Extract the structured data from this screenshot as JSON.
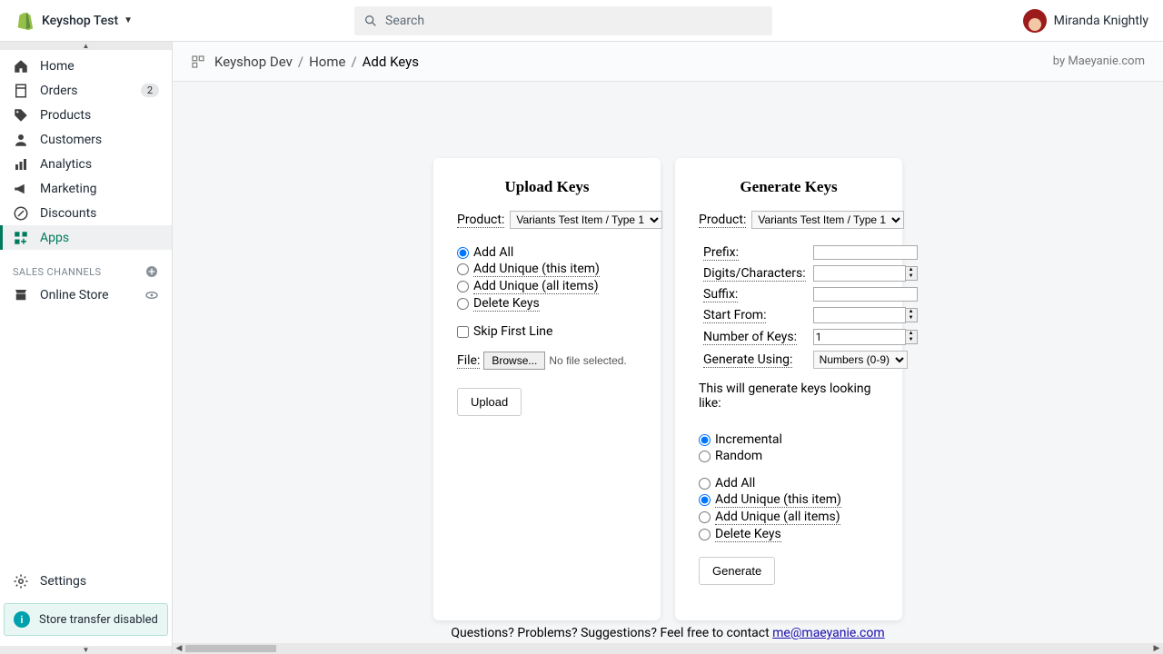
{
  "topbar": {
    "store_name": "Keyshop Test",
    "search_placeholder": "Search",
    "user_name": "Miranda Knightly"
  },
  "nav": {
    "items": [
      {
        "label": "Home"
      },
      {
        "label": "Orders",
        "badge": "2"
      },
      {
        "label": "Products"
      },
      {
        "label": "Customers"
      },
      {
        "label": "Analytics"
      },
      {
        "label": "Marketing"
      },
      {
        "label": "Discounts"
      },
      {
        "label": "Apps"
      }
    ],
    "section": "SALES CHANNELS",
    "channel": "Online Store",
    "settings": "Settings",
    "notice": "Store transfer disabled"
  },
  "crumbs": {
    "a": "Keyshop Dev",
    "b": "Home",
    "c": "Add Keys",
    "by": "by Maeyanie.com"
  },
  "upload": {
    "title": "Upload Keys",
    "product_label": "Product:",
    "product_value": "Variants Test Item / Type 1",
    "r1": "Add All",
    "r2": "Add Unique (this item)",
    "r3": "Add Unique (all items)",
    "r4": "Delete Keys",
    "skip": "Skip First Line",
    "file_label": "File:",
    "browse": "Browse...",
    "nofile": "No file selected.",
    "btn": "Upload"
  },
  "gen": {
    "title": "Generate Keys",
    "product_label": "Product:",
    "product_value": "Variants Test Item / Type 1",
    "prefix": "Prefix:",
    "digits": "Digits/Characters:",
    "suffix": "Suffix:",
    "start": "Start From:",
    "numkeys_label": "Number of Keys:",
    "numkeys_value": "1",
    "using_label": "Generate Using:",
    "using_value": "Numbers (0-9)",
    "preview": "This will generate keys looking like:",
    "m1": "Incremental",
    "m2": "Random",
    "a1": "Add All",
    "a2": "Add Unique (this item)",
    "a3": "Add Unique (all items)",
    "a4": "Delete Keys",
    "btn": "Generate"
  },
  "footer": {
    "text": "Questions? Problems? Suggestions? Feel free to contact ",
    "email": "me@maeyanie.com"
  }
}
